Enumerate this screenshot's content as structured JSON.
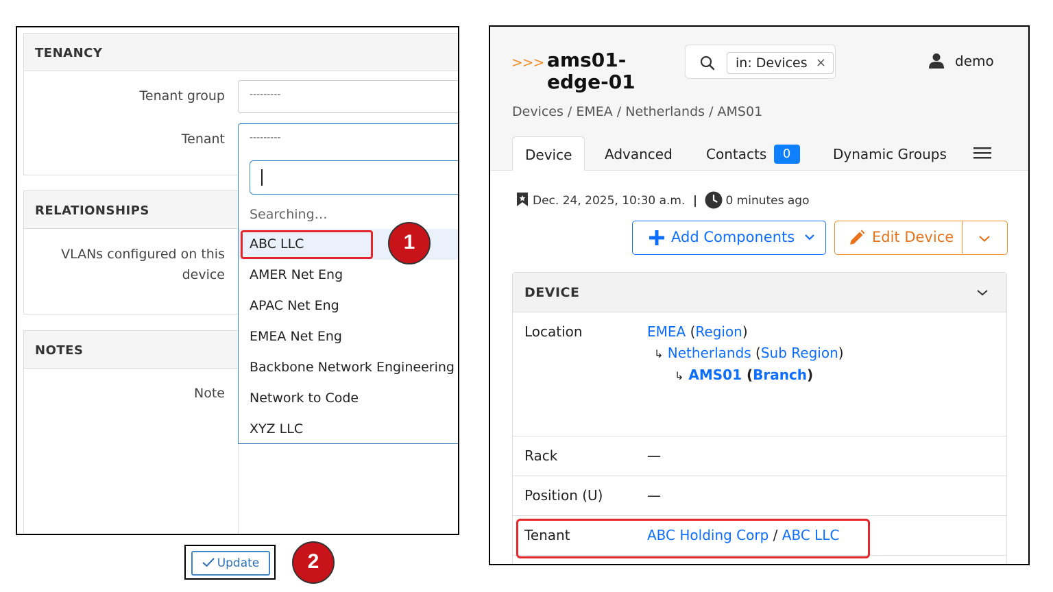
{
  "left": {
    "tenancy": {
      "title": "TENANCY",
      "tenant_group_label": "Tenant group",
      "tenant_group_value": "---------",
      "tenant_label": "Tenant",
      "tenant_value": "---------"
    },
    "relationships": {
      "title": "RELATIONSHIPS",
      "vlans_label_line1": "VLANs configured on this",
      "vlans_label_line2": "device"
    },
    "notes": {
      "title": "NOTES",
      "note_label": "Note"
    },
    "dropdown": {
      "search_value": "",
      "searching_text": "Searching…",
      "options": [
        "ABC LLC",
        "AMER Net Eng",
        "APAC Net Eng",
        "EMEA Net Eng",
        "Backbone Network Engineering",
        "Network to Code",
        "XYZ LLC"
      ],
      "highlighted": "ABC LLC"
    },
    "update_label": "Update",
    "badges": [
      "1",
      "2"
    ]
  },
  "right": {
    "chevrons": ">>>",
    "title_line1": "ams01-",
    "title_line2": "edge-01",
    "search_chip": "in: Devices",
    "chip_close": "×",
    "user": "demo",
    "breadcrumb": "Devices / EMEA / Netherlands / AMS01",
    "tabs": {
      "device": "Device",
      "advanced": "Advanced",
      "contacts": "Contacts",
      "contacts_count": "0",
      "dynamic_groups": "Dynamic Groups"
    },
    "meta": {
      "date": "Dec. 24, 2025, 10:30 a.m.",
      "separator": "|",
      "ago": "0 minutes ago"
    },
    "buttons": {
      "add_components": "Add Components",
      "edit_device": "Edit Device"
    },
    "card": {
      "title": "DEVICE",
      "location_label": "Location",
      "loc1": "EMEA",
      "loc1_type": "Region",
      "loc2": "Netherlands",
      "loc2_type": "Sub Region",
      "loc3": "AMS01",
      "loc3_type": "Branch",
      "rack_label": "Rack",
      "rack_value": "—",
      "position_label": "Position (U)",
      "position_value": "—",
      "tenant_label": "Tenant",
      "tenant_group": "ABC Holding Corp",
      "tenant_sep": "/",
      "tenant": "ABC LLC"
    },
    "colors": {
      "accent": "#0d6efd",
      "orange": "#f28c28",
      "highlight": "#e4262c"
    }
  }
}
